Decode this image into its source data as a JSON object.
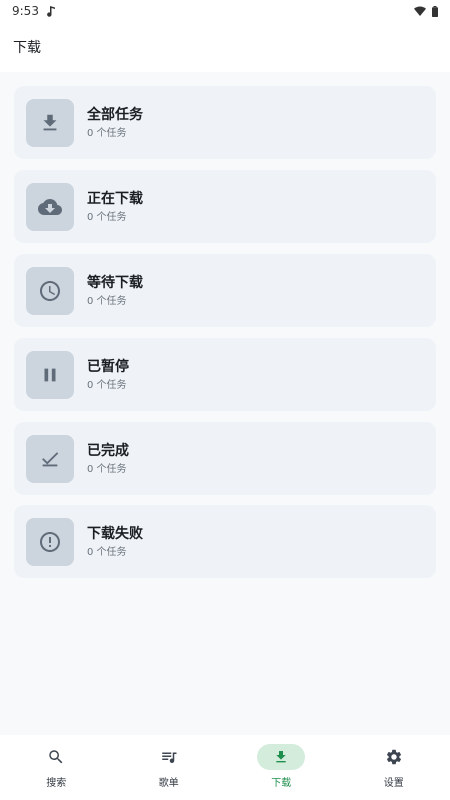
{
  "status_bar": {
    "time": "9:53",
    "icons": [
      "music-note-icon",
      "wifi-icon",
      "battery-icon"
    ]
  },
  "app_bar": {
    "title": "下载"
  },
  "categories": [
    {
      "title": "全部任务",
      "count": "0 个任务",
      "icon": "download-icon"
    },
    {
      "title": "正在下载",
      "count": "0 个任务",
      "icon": "cloud-download-icon"
    },
    {
      "title": "等待下载",
      "count": "0 个任务",
      "icon": "clock-icon"
    },
    {
      "title": "已暂停",
      "count": "0 个任务",
      "icon": "pause-icon"
    },
    {
      "title": "已完成",
      "count": "0 个任务",
      "icon": "check-icon"
    },
    {
      "title": "下载失败",
      "count": "0 个任务",
      "icon": "error-icon"
    }
  ],
  "bottom_nav": {
    "items": [
      {
        "label": "搜索",
        "icon": "search-icon",
        "active": false
      },
      {
        "label": "歌单",
        "icon": "playlist-icon",
        "active": false
      },
      {
        "label": "下载",
        "icon": "download-icon",
        "active": true
      },
      {
        "label": "设置",
        "icon": "gear-icon",
        "active": false
      }
    ]
  },
  "colors": {
    "accent": "#1f8f4e",
    "active_pill": "#d3ecdc",
    "card_bg": "#eff3f7",
    "icon_box": "#ccd4de",
    "icon_fill": "#5f6b78"
  }
}
